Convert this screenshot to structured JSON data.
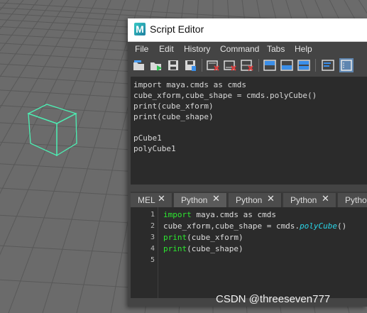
{
  "window": {
    "app_icon": "maya-m-logo",
    "app_letter": "M",
    "title": "Script Editor"
  },
  "menu": [
    "File",
    "Edit",
    "History",
    "Command",
    "Tabs",
    "Help"
  ],
  "toolbar": {
    "icons": [
      "open-script-icon",
      "source-script-icon",
      "save-script-icon",
      "save-to-shelf-icon",
      "clear-history-icon",
      "clear-input-icon",
      "clear-all-icon",
      "show-history-only-icon",
      "show-input-only-icon",
      "show-both-icon",
      "echo-all-commands-icon",
      "line-numbers-icon"
    ]
  },
  "history": {
    "lines": [
      "import maya.cmds as cmds",
      "cube_xform,cube_shape = cmds.polyCube()",
      "print(cube_xform)",
      "print(cube_shape)",
      "",
      "pCube1",
      "polyCube1"
    ]
  },
  "tabs": [
    {
      "label": "MEL",
      "close": "✕"
    },
    {
      "label": "Python",
      "close": "✕"
    },
    {
      "label": "Python",
      "close": "✕"
    },
    {
      "label": "Python",
      "close": "✕"
    },
    {
      "label": "Pytho",
      "close": ""
    }
  ],
  "input": {
    "line_numbers": [
      "1",
      "2",
      "3",
      "4",
      "5"
    ],
    "lines": [
      {
        "kw": "import",
        "rest": " maya.cmds as cmds"
      },
      {
        "pre": "cube_xform,cube_shape = cmds.",
        "fn": "polyCube",
        "post": "()"
      },
      {
        "kw": "print",
        "rest": "(cube_xform)"
      },
      {
        "kw": "print",
        "rest": "(cube_shape)"
      },
      {
        "rest": ""
      }
    ]
  },
  "watermark": "CSDN @threeseven777",
  "colors": {
    "viewport_bg": "#6a6a6a",
    "grid_line": "#5a5a5a",
    "selection": "#4cf0b4",
    "keyword": "#2de830",
    "function": "#2ad6e8",
    "editor_bg": "#2b2b2b",
    "panel_bg": "#444444"
  }
}
